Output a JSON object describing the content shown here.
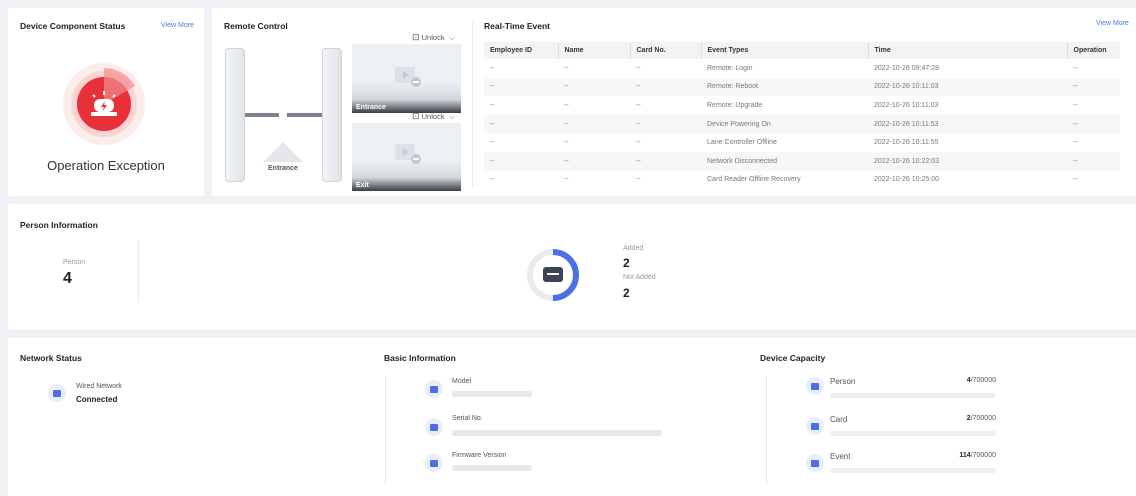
{
  "device_component_status": {
    "title": "Device Component Status",
    "view_more": "View More",
    "status": "Operation Exception",
    "icon_color": "#e8313a"
  },
  "remote_control": {
    "title": "Remote Control",
    "gate_label": "Entrance",
    "cameras": [
      {
        "unlock": "Unlock",
        "label": "Entrance"
      },
      {
        "unlock": "Unlock",
        "label": "Exit"
      }
    ]
  },
  "real_time_event": {
    "title": "Real-Time Event",
    "view_more": "View More",
    "columns": [
      "Employee ID",
      "Name",
      "Card No.",
      "Event Types",
      "Time",
      "Operation"
    ],
    "rows": [
      [
        "--",
        "--",
        "--",
        "Remote: Login",
        "2022-10-26 09:47:28",
        "--"
      ],
      [
        "--",
        "--",
        "--",
        "Remote: Reboot",
        "2022-10-26 10:11:03",
        "--"
      ],
      [
        "--",
        "--",
        "--",
        "Remote: Upgrade",
        "2022-10-26 10:11:03",
        "--"
      ],
      [
        "--",
        "--",
        "--",
        "Device Powering On",
        "2022-10-26 10:11:53",
        "--"
      ],
      [
        "--",
        "--",
        "--",
        "Lane Controller Offline",
        "2022-10-26 10:11:55",
        "--"
      ],
      [
        "--",
        "--",
        "--",
        "Network Disconnected",
        "2022-10-26 10:22:03",
        "--"
      ],
      [
        "--",
        "--",
        "--",
        "Card Reader Offline Recovery",
        "2022-10-26 10:25:00",
        "--"
      ]
    ]
  },
  "person_information": {
    "title": "Person Information",
    "person_label": "Person",
    "person_count": "4",
    "added_label": "Added",
    "added_value": "2",
    "not_added_label": "Not Added",
    "not_added_value": "2",
    "added_fraction": 0.5,
    "accent": "#4d6fe6"
  },
  "network_status": {
    "title": "Network Status",
    "label": "Wired Network",
    "value": "Connected"
  },
  "basic_information": {
    "title": "Basic Information",
    "fields": [
      "Model",
      "Serial No.",
      "Firmware Version"
    ]
  },
  "device_capacity": {
    "title": "Device Capacity",
    "items": [
      {
        "label": "Person",
        "used": "4",
        "total": "/700000"
      },
      {
        "label": "Card",
        "used": "2",
        "total": "/700000"
      },
      {
        "label": "Event",
        "used": "114",
        "total": "/700000"
      }
    ]
  }
}
